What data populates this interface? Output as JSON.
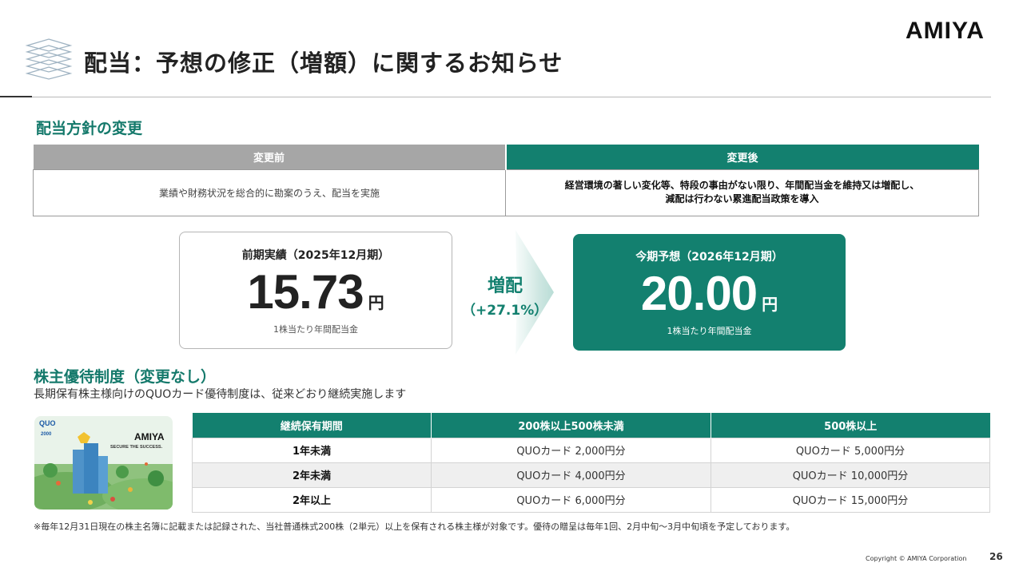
{
  "header": {
    "title": "配当：予想の修正（増額）に関するお知らせ",
    "brand": "AMIYA"
  },
  "policy": {
    "heading": "配当方針の変更",
    "before_label": "変更前",
    "after_label": "変更後",
    "before_text": "業績や財務状況を総合的に勘案のうえ、配当を実施",
    "after_text_line1": "経営環境の著しい変化等、特段の事由がない限り、年間配当金を維持又は増配し、",
    "after_text_line2": "減配は行わない累進配当政策を導入"
  },
  "previous": {
    "label": "前期実績（2025年12月期）",
    "value": "15.73",
    "unit": "円",
    "sub": "1株当たり年間配当金"
  },
  "increase": {
    "label": "増配",
    "pct": "（+27.1%）"
  },
  "forecast": {
    "label": "今期予想（2026年12月期）",
    "value": "20.00",
    "unit": "円",
    "sub": "1株当たり年間配当金"
  },
  "yutai": {
    "heading": "株主優待制度（変更なし）",
    "subtitle": "長期保有株主様向けのQUOカード優待制度は、従来どおり継続実施します",
    "card_brand": "AMIYA",
    "card_tagline": "SECURE THE SUCCESS.",
    "card_quo": "QUO",
    "card_amount": "2000",
    "columns": [
      "継続保有期間",
      "200株以上500株未満",
      "500株以上"
    ],
    "rows": [
      [
        "1年未満",
        "QUOカード 2,000円分",
        "QUOカード 5,000円分"
      ],
      [
        "2年未満",
        "QUOカード 4,000円分",
        "QUOカード 10,000円分"
      ],
      [
        "2年以上",
        "QUOカード 6,000円分",
        "QUOカード 15,000円分"
      ]
    ],
    "note": "※毎年12月31日現在の株主名簿に記載または記録された、当社普通株式200株（2単元）以上を保有される株主様が対象です。優待の贈呈は毎年1回、2月中旬〜3月中旬頃を予定しております。"
  },
  "footer": {
    "copyright": "Copyright © AMIYA Corporation",
    "page": "26"
  },
  "colors": {
    "accent": "#13806f",
    "header_gray": "#a6a6a6"
  }
}
